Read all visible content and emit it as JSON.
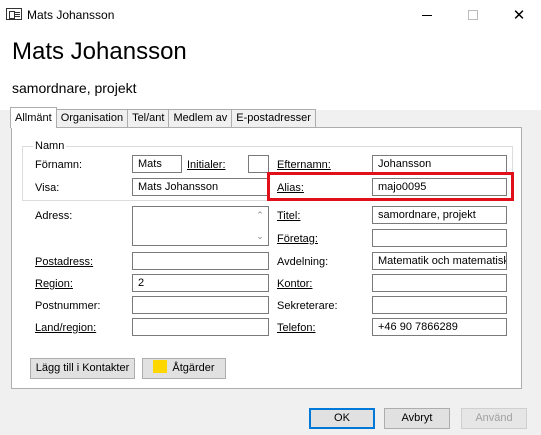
{
  "window": {
    "title": "Mats Johansson",
    "controls": {
      "minimize": "minimize",
      "maximize": "maximize",
      "close": "✕"
    }
  },
  "header": {
    "name": "Mats Johansson",
    "subtitle": "samordnare, projekt"
  },
  "tabs": [
    {
      "label": "Allmänt",
      "active": true
    },
    {
      "label": "Organisation",
      "active": false
    },
    {
      "label": "Tel/ant",
      "active": false
    },
    {
      "label": "Medlem av",
      "active": false
    },
    {
      "label": "E-postadresser",
      "active": false
    }
  ],
  "name_group": {
    "legend": "Namn",
    "first_name_label": "Förnamn:",
    "first_name_value": "Mats",
    "initials_label": "Initialer:",
    "initials_value": "",
    "last_name_label": "Efternamn:",
    "last_name_value": "Johansson",
    "display_label": "Visa:",
    "display_value": "Mats Johansson",
    "alias_label": "Alias:",
    "alias_value": "majo0095"
  },
  "left_fields": {
    "address_label": "Adress:",
    "address_value": "",
    "postal_address_label": "Postadress:",
    "postal_address_value": "",
    "region_label": "Region:",
    "region_value": "2",
    "postal_code_label": "Postnummer:",
    "postal_code_value": "",
    "country_label": "Land/region:",
    "country_value": ""
  },
  "right_fields": {
    "title_label": "Titel:",
    "title_value": "samordnare, projekt",
    "company_label": "Företag:",
    "company_value": "",
    "department_label": "Avdelning:",
    "department_value": "Matematik och matematisk",
    "office_label": "Kontor:",
    "office_value": "",
    "assistant_label": "Sekreterare:",
    "assistant_value": "",
    "phone_label": "Telefon:",
    "phone_value": "+46 90 7866289"
  },
  "actions": {
    "add_to_contacts": "Lägg till i Kontakter",
    "actions_label": "Åtgärder"
  },
  "footer": {
    "ok": "OK",
    "cancel": "Avbryt",
    "apply": "Använd"
  },
  "colors": {
    "highlight_border": "#e0101a",
    "actions_swatch": "#ffd700",
    "default_button_border": "#0078d7"
  }
}
